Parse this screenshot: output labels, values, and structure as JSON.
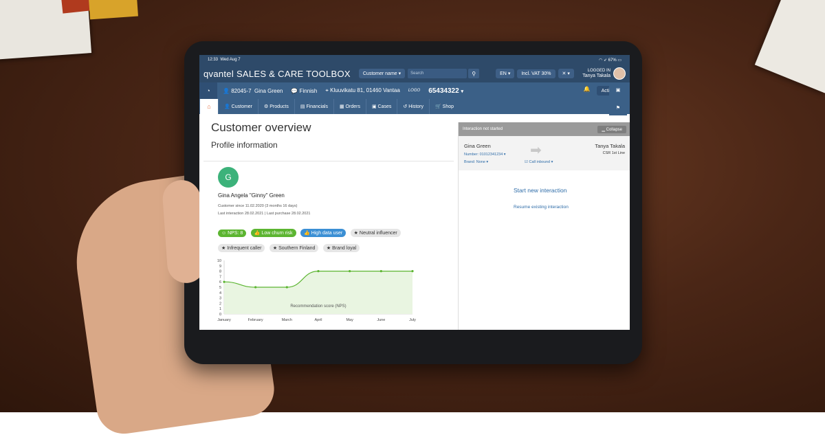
{
  "status_bar": {
    "time": "12:33",
    "date": "Wed Aug 7",
    "battery": "67%"
  },
  "header": {
    "brand_logo": "qvantel",
    "brand_title": "SALES & CARE TOOLBOX",
    "search_type": "Customer name",
    "search_placeholder": "Search",
    "language": "EN",
    "vat": "Incl. VAT 30%",
    "logged_in_label": "LOGGED IN",
    "user": "Tanya Takala"
  },
  "customer_bar": {
    "id": "82045-7",
    "name": "Gina Green",
    "language": "Finnish",
    "address": "Kluuvikatu 81, 01460 Vantaa",
    "logo_text": "LOGO",
    "phone": "65434322",
    "actions_label": "Actions"
  },
  "tabs": [
    "Customer",
    "Products",
    "Financials",
    "Orders",
    "Cases",
    "History",
    "Shop"
  ],
  "overview": {
    "title": "Customer overview",
    "subtitle": "Profile information",
    "avatar_initial": "G",
    "full_name": "Gina Angela \"Ginny\" Green",
    "customer_since": "Customer since 11.02.2020 (3 months 16 days)",
    "last_activity": "Last interaction 28.02.2021  |  Last purchase 28.02.2021",
    "tags": [
      {
        "label": "NPS: 8",
        "style": "green",
        "icon": "smile-icon"
      },
      {
        "label": "Low churn risk",
        "style": "green",
        "icon": "thumbs-up-icon"
      },
      {
        "label": "High data user",
        "style": "blue",
        "icon": "thumbs-up-icon"
      },
      {
        "label": "Neutral influencer",
        "style": "grey",
        "icon": "star-icon"
      },
      {
        "label": "Infrequent caller",
        "style": "grey",
        "icon": "star-icon"
      },
      {
        "label": "Southern Finland",
        "style": "grey",
        "icon": "star-icon"
      },
      {
        "label": "Brand loyal",
        "style": "grey",
        "icon": "star-icon"
      }
    ]
  },
  "chart_data": {
    "type": "area",
    "title": "",
    "xlabel": "",
    "ylabel": "",
    "categories": [
      "January",
      "February",
      "March",
      "April",
      "May",
      "June",
      "July"
    ],
    "series": [
      {
        "name": "Recommendation score (NPS)",
        "values": [
          6,
          5,
          5,
          8,
          8,
          8,
          8
        ]
      }
    ],
    "ylim": [
      0,
      10
    ],
    "yticks": [
      0,
      1,
      2,
      3,
      4,
      5,
      6,
      7,
      8,
      9,
      10
    ],
    "color": "#5cb531",
    "fill": "#e9f5e1"
  },
  "interaction": {
    "status": "Interaction not started",
    "collapse_label": "Collapse",
    "customer": "Gina Green",
    "number": "Number: 01012341234",
    "brand": "Brand: None",
    "call_type": "Call inbound",
    "agent": "Tanya Takala",
    "agent_role": "CSR 1st Line",
    "start_label": "Start new interaction",
    "resume_label": "Resume existing interaction"
  }
}
